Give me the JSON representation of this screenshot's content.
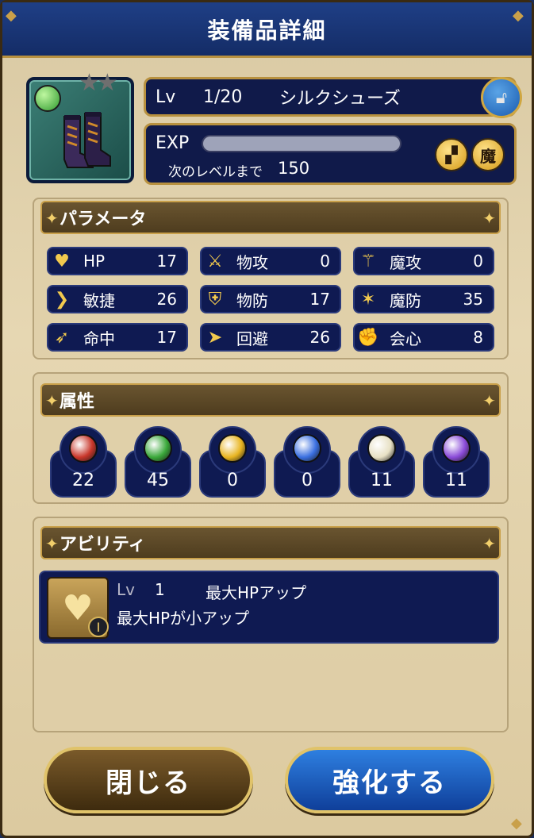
{
  "window_title": "装備品詳細",
  "item": {
    "level_label": "Lv",
    "level": "1/20",
    "name": "シルクシューズ",
    "exp_label": "EXP",
    "exp_progress": 0.0,
    "next_label": "次のレベルまで",
    "next_value": "150",
    "badge_magic": "魔"
  },
  "sections": {
    "params_title": "パラメータ",
    "attributes_title": "属性",
    "ability_title": "アビリティ"
  },
  "params": [
    {
      "label": "HP",
      "value": "17",
      "icon": "heart-icon"
    },
    {
      "label": "物攻",
      "value": "0",
      "icon": "sword-icon"
    },
    {
      "label": "魔攻",
      "value": "0",
      "icon": "staff-icon"
    },
    {
      "label": "敏捷",
      "value": "26",
      "icon": "wing-boot-icon"
    },
    {
      "label": "物防",
      "value": "17",
      "icon": "shield-icon"
    },
    {
      "label": "魔防",
      "value": "35",
      "icon": "magic-guard-icon"
    },
    {
      "label": "命中",
      "value": "17",
      "icon": "bow-icon"
    },
    {
      "label": "回避",
      "value": "26",
      "icon": "dodge-icon"
    },
    {
      "label": "会心",
      "value": "8",
      "icon": "fist-icon"
    }
  ],
  "attributes": [
    {
      "value": "22",
      "color": "#c8362a"
    },
    {
      "value": "45",
      "color": "#3aa83a"
    },
    {
      "value": "0",
      "color": "#e8b420"
    },
    {
      "value": "0",
      "color": "#3a6fe0"
    },
    {
      "value": "11",
      "color": "#e7e0c4"
    },
    {
      "value": "11",
      "color": "#8a4ad8"
    }
  ],
  "ability": {
    "level_label": "Lv",
    "level": "1",
    "name": "最大HPアップ",
    "description": "最大HPが小アップ"
  },
  "buttons": {
    "close": "閉じる",
    "enhance": "強化する"
  }
}
